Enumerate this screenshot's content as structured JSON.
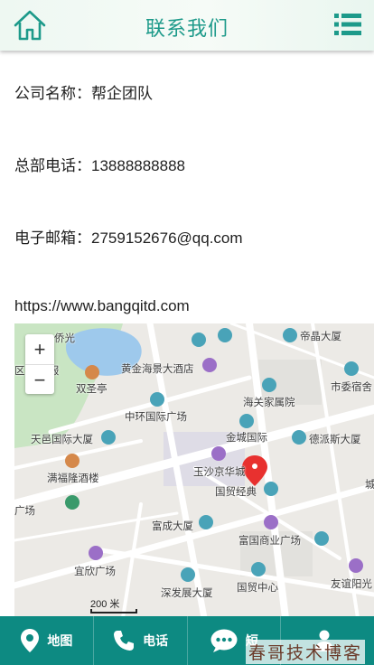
{
  "header": {
    "title": "联系我们"
  },
  "contact": {
    "company_label": "公司名称：",
    "company_value": "帮企团队",
    "phone_label": "总部电话：",
    "phone_value": "13888888888",
    "email_label": "电子邮箱：",
    "email_value": "2759152676@qq.com",
    "website": "https://www.bangqitd.com"
  },
  "map": {
    "zoom_in": "+",
    "zoom_out": "−",
    "scale": "200 米",
    "pois": [
      "侨光",
      "帝晶大厦",
      "区 政务服",
      "黄金海景大酒店",
      "市委宿舍",
      "双圣亭",
      "海关家属院",
      "中环国际广场",
      "金城国际",
      "天邑国际大厦",
      "德派斯大厦",
      "满福隆酒楼",
      "玉沙京华城",
      "国贸经典",
      "城",
      "广场",
      "富成大厦",
      "富国商业广场",
      "宜欣广场",
      "深发展大厦",
      "国贸中心",
      "友谊阳光"
    ]
  },
  "tabbar": {
    "items": [
      {
        "label": "地图",
        "icon": "location-pin-icon"
      },
      {
        "label": "电话",
        "icon": "phone-icon"
      },
      {
        "label": "短",
        "icon": "chat-bubble-icon"
      },
      {
        "label": "",
        "icon": "person-icon"
      }
    ]
  },
  "watermark": "春哥技术博客",
  "colors": {
    "accent": "#0d8a82",
    "title": "#1d9a8a",
    "pin": "#e8312f"
  }
}
